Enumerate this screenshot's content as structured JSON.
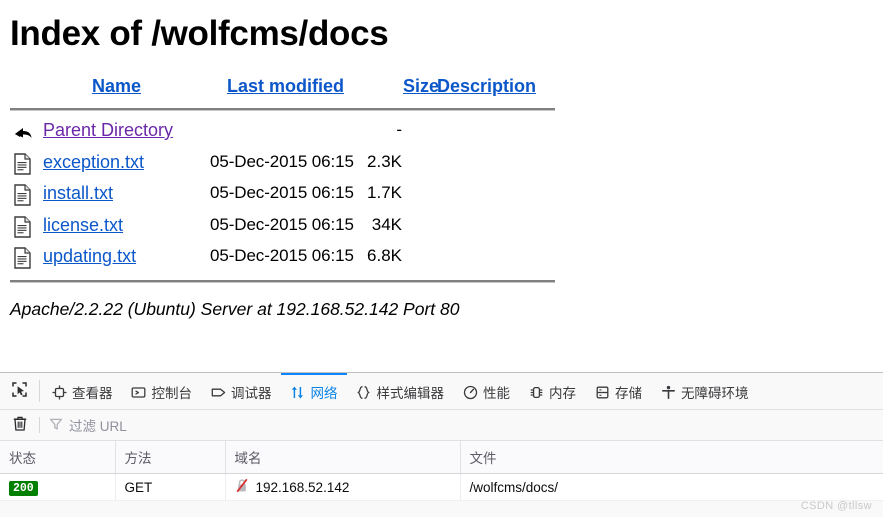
{
  "page": {
    "title": "Index of /wolfcms/docs",
    "columns": {
      "name": "Name",
      "last_modified": "Last modified",
      "size": "Size",
      "description": "Description"
    },
    "rows": [
      {
        "icon": "parent-directory-icon",
        "name": "Parent Directory",
        "last_modified": "",
        "size": "-",
        "description": ""
      },
      {
        "icon": "text-file-icon",
        "name": "exception.txt",
        "last_modified": "05-Dec-2015 06:15",
        "size": "2.3K",
        "description": ""
      },
      {
        "icon": "text-file-icon",
        "name": "install.txt",
        "last_modified": "05-Dec-2015 06:15",
        "size": "1.7K",
        "description": ""
      },
      {
        "icon": "text-file-icon",
        "name": "license.txt",
        "last_modified": "05-Dec-2015 06:15",
        "size": "34K",
        "description": ""
      },
      {
        "icon": "text-file-icon",
        "name": "updating.txt",
        "last_modified": "05-Dec-2015 06:15",
        "size": "6.8K",
        "description": ""
      }
    ],
    "server_signature": "Apache/2.2.22 (Ubuntu) Server at 192.168.52.142 Port 80",
    "link_color": "#0b57c9",
    "visited_link_color": "#6a28a8"
  },
  "devtools": {
    "picker_icon": "element-picker-icon",
    "tabs": [
      {
        "label": "查看器",
        "icon": "inspector-icon",
        "active": false
      },
      {
        "label": "控制台",
        "icon": "console-icon",
        "active": false
      },
      {
        "label": "调试器",
        "icon": "debugger-icon",
        "active": false
      },
      {
        "label": "网络",
        "icon": "network-icon",
        "active": true
      },
      {
        "label": "样式编辑器",
        "icon": "style-editor-icon",
        "active": false
      },
      {
        "label": "性能",
        "icon": "performance-icon",
        "active": false
      },
      {
        "label": "内存",
        "icon": "memory-icon",
        "active": false
      },
      {
        "label": "存储",
        "icon": "storage-icon",
        "active": false
      },
      {
        "label": "无障碍环境",
        "icon": "accessibility-icon",
        "active": false
      }
    ],
    "active_tab_color": "#0a84e8",
    "filterbar": {
      "clear_icon": "trash-icon",
      "filter_icon": "filter-icon",
      "filter_placeholder": "过滤 URL"
    },
    "table": {
      "headers": [
        "状态",
        "方法",
        "域名",
        "文件"
      ],
      "rows": [
        {
          "status": "200",
          "status_color": "#018000",
          "method": "GET",
          "domain_icon": "insecure-lock-icon",
          "domain": "192.168.52.142",
          "file": "/wolfcms/docs/"
        }
      ]
    }
  },
  "watermark": "CSDN @tllsw"
}
